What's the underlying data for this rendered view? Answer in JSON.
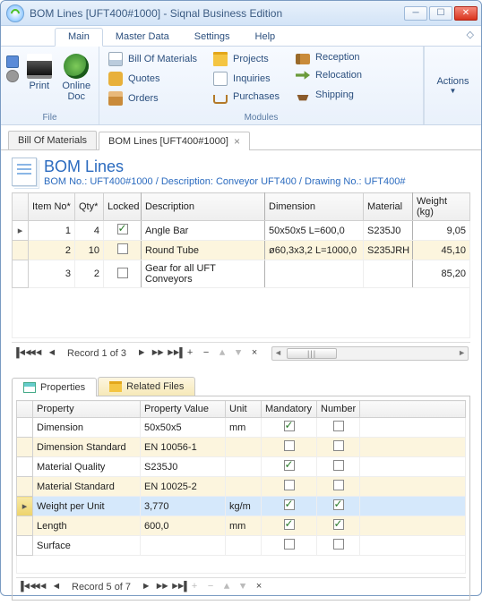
{
  "window": {
    "title": "BOM Lines [UFT400#1000] - Siqnal Business Edition"
  },
  "ribbon": {
    "tabs": [
      "Main",
      "Master Data",
      "Settings",
      "Help"
    ],
    "active": 0,
    "file_label": "File",
    "modules_label": "Modules",
    "print": "Print",
    "online_doc": "Online\nDoc",
    "bom": "Bill Of Materials",
    "quotes": "Quotes",
    "orders": "Orders",
    "projects": "Projects",
    "inquiries": "Inquiries",
    "purchases": "Purchases",
    "reception": "Reception",
    "relocation": "Relocation",
    "shipping": "Shipping",
    "actions": "Actions"
  },
  "doc_tabs": {
    "t0": "Bill Of Materials",
    "t1": "BOM Lines [UFT400#1000]"
  },
  "page": {
    "title": "BOM Lines",
    "subtitle": "BOM No.: UFT400#1000 / Description: Conveyor UFT400 / Drawing No.: UFT400#"
  },
  "grid1": {
    "cols": {
      "item": "Item No*",
      "qty": "Qty*",
      "locked": "Locked",
      "desc": "Description",
      "dim": "Dimension",
      "mat": "Material",
      "wt": "Weight (kg)"
    },
    "rows": [
      {
        "item": "1",
        "qty": "4",
        "locked": true,
        "desc": "Angle Bar",
        "dim": "50x50x5 L=600,0",
        "mat": "S235J0",
        "wt": "9,05"
      },
      {
        "item": "2",
        "qty": "10",
        "locked": false,
        "desc": "Round Tube",
        "dim": "ø60,3x3,2 L=1000,0",
        "mat": "S235JRH",
        "wt": "45,10"
      },
      {
        "item": "3",
        "qty": "2",
        "locked": false,
        "desc": "Gear for all UFT Conveyors",
        "dim": "",
        "mat": "",
        "wt": "85,20"
      }
    ],
    "nav": "Record 1 of 3"
  },
  "subtabs": {
    "properties": "Properties",
    "related": "Related Files"
  },
  "grid2": {
    "cols": {
      "prop": "Property",
      "val": "Property Value",
      "unit": "Unit",
      "mand": "Mandatory",
      "num": "Number"
    },
    "rows": [
      {
        "prop": "Dimension",
        "val": "50x50x5",
        "unit": "mm",
        "mand": true,
        "num": false
      },
      {
        "prop": "Dimension Standard",
        "val": "EN 10056-1",
        "unit": "",
        "mand": false,
        "num": false
      },
      {
        "prop": "Material Quality",
        "val": "S235J0",
        "unit": "",
        "mand": true,
        "num": false
      },
      {
        "prop": "Material Standard",
        "val": "EN 10025-2",
        "unit": "",
        "mand": false,
        "num": false
      },
      {
        "prop": "Weight per Unit",
        "val": "3,770",
        "unit": "kg/m",
        "mand": true,
        "num": true
      },
      {
        "prop": "Length",
        "val": "600,0",
        "unit": "mm",
        "mand": true,
        "num": true
      },
      {
        "prop": "Surface",
        "val": "",
        "unit": "",
        "mand": false,
        "num": false
      }
    ],
    "selected": 4,
    "nav": "Record 5 of 7"
  }
}
